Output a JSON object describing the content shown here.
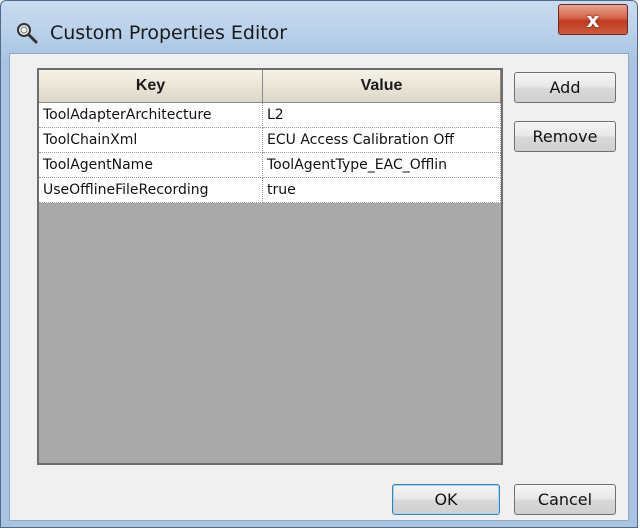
{
  "window": {
    "title": "Custom Properties Editor",
    "close_glyph": "x",
    "title_icon": "magnifier-icon"
  },
  "table": {
    "columns": [
      "Key",
      "Value"
    ],
    "rows": [
      {
        "key": "ToolAdapterArchitecture",
        "value": "L2"
      },
      {
        "key": "ToolChainXml",
        "value": "ECU Access Calibration Off"
      },
      {
        "key": "ToolAgentName",
        "value": "ToolAgentType_EAC_Offlin"
      },
      {
        "key": "UseOfflineFileRecording",
        "value": "true"
      }
    ]
  },
  "buttons": {
    "add": "Add",
    "remove": "Remove",
    "ok": "OK",
    "cancel": "Cancel"
  },
  "colors": {
    "header_bg": "#ece8da",
    "empty_grid_bg": "#a9a9a9",
    "close_button": "#c94a2e",
    "title_bar": "#b9d1ea"
  }
}
